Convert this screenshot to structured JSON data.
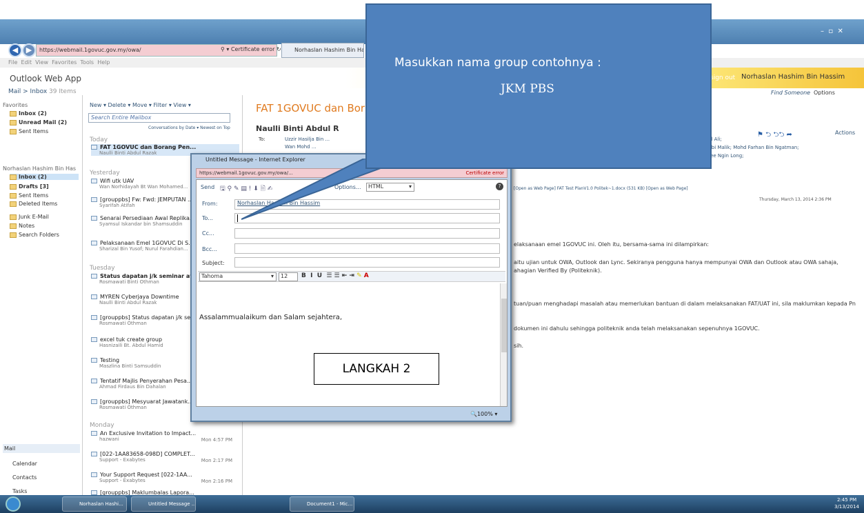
{
  "browser": {
    "url": "https://webmail.1govuc.gov.my/owa/",
    "cert": "Certificate error",
    "tab_title": "Norhaslan Hashim Bin Hass...",
    "menu": [
      "File",
      "Edit",
      "View",
      "Favorites",
      "Tools",
      "Help"
    ]
  },
  "owa": {
    "logo": "Outlook Web App",
    "signout": "sign out",
    "user": "Norhaslan Hashim Bin Hassim",
    "find": "Find Someone",
    "options": "Options",
    "breadcrumb": "Mail > Inbox",
    "count": "39 Items"
  },
  "nav": {
    "favorites": "Favorites",
    "inbox": "Inbox (2)",
    "unread": "Unread Mail (2)",
    "sent": "Sent Items",
    "account": "Norhaslan Hashim Bin Has",
    "inbox2": "Inbox (2)",
    "drafts": "Drafts [3]",
    "sent2": "Sent Items",
    "deleted": "Deleted Items",
    "junk": "Junk E-Mail",
    "notes": "Notes",
    "search": "Search Folders",
    "mail": "Mail",
    "calendar": "Calendar",
    "contacts": "Contacts",
    "tasks": "Tasks"
  },
  "list": {
    "toolbar": "New ▾  Delete ▾  Move ▾  Filter ▾  View ▾",
    "search": "Search Entire Mailbox",
    "sort": "Conversations by Date ▾  Newest on Top",
    "today": "Today",
    "yesterday": "Yesterday",
    "tuesday": "Tuesday",
    "monday": "Monday",
    "items": [
      {
        "s": "FAT 1GOVUC dan Borang Pen...",
        "f": "Naulli Binti Abdul Razak"
      },
      {
        "s": "Wifi utk UAV",
        "f": "Wan Norhidayah Bt Wan Mohamed..."
      },
      {
        "s": "[grouppbs] Fw: Fwd: JEMPUTAN ...",
        "f": "Syarifah Atifah"
      },
      {
        "s": "Senarai Persediaan Awal Replika...",
        "f": "Syamsul Iskandar bin Shamsuddin"
      },
      {
        "s": "Pelaksanaan Emel 1GOVUC Di S...",
        "f": "Sharizal Bin Yusof; Nurul Farahdian..."
      },
      {
        "s": "Status dapatan j/k seminar avi...",
        "f": "Rosmawati Binti Othman"
      },
      {
        "s": "MYREN Cyberjaya Downtime",
        "f": "Naulli Binti Abdul Razak"
      },
      {
        "s": "[grouppbs] Status dapatan j/k se...",
        "f": "Rosmawati Othman"
      },
      {
        "s": "excel tuk create group",
        "f": "Hasnizaili Bt. Abdul Hamid"
      },
      {
        "s": "Testing",
        "f": "Maszlina Binti Samsuddin"
      },
      {
        "s": "Tentatif Majlis Penyerahan Pesa...",
        "f": "Ahmad Firdaus Bin Dahalan"
      },
      {
        "s": "[grouppbs] Mesyuarat Jawatank...",
        "f": "Rosmawati Othman"
      },
      {
        "s": "An Exclusive Invitation to Impact...",
        "f": "hazwani",
        "t": "Mon 4:57 PM"
      },
      {
        "s": "[022-1AA83658-098D] COMPLET...",
        "f": "Support - Exabytes",
        "t": "Mon 2:17 PM"
      },
      {
        "s": "Your Support Request [022-1AA...",
        "f": "Support - Exabytes",
        "t": "Mon 2:16 PM"
      },
      {
        "s": "[grouppbs] Maklumbalas Lapora...",
        "f": ""
      }
    ]
  },
  "reading": {
    "subject": "FAT 1GOVUC dan Bor",
    "sender": "Naulli Binti Abdul R",
    "to_label": "To:",
    "to1": "Uzzir Hasilja Bin ...",
    "to2": "Wan Mohd ...",
    "cc1": "ul Ali;",
    "cc2": "Abi Malik; Mohd Farhan Bin Ngatman;",
    "cc3": "Tee Ngin Long;",
    "actions": "Actions",
    "attach": "[Open as Web Page]  FAT Test PlanV1.0 Politek~1.docx (531 KB) [Open as Web Page]",
    "date": "Thursday, March 13, 2014 2:36 PM",
    "b1": "elaksanaan emel 1GOVUC ini. Oleh itu, bersama-sama ini dilampirkan:",
    "b2": "aitu ujian untuk OWA, Outlook dan Lync. Sekiranya pengguna hanya mempunyai OWA dan Outlook atau OWA sahaja,",
    "b3": "ahagian Verified By (Politeknik).",
    "b4": "tuan/puan menghadapi masalah atau memerlukan bantuan di dalam melaksanakan FAT/UAT ini, sila maklumkan kepada Pn",
    "b5": "dokumen ini dahulu sehingga politeknik anda telah melaksanakan sepenuhnya 1GOVUC.",
    "b6": "sih."
  },
  "popup": {
    "title": "Untitled Message - Internet Explorer",
    "url": "https://webmail.1govuc.gov.my/owa/...",
    "cert": "Certificate error",
    "send": "Send",
    "options": "Options...",
    "format": "HTML",
    "from_label": "From:",
    "from": "Norhaslan Hashim Bin Hassim",
    "to_label": "To...",
    "cc_label": "Cc...",
    "bcc_label": "Bcc...",
    "subject_label": "Subject:",
    "font": "Tahoma",
    "size": "12",
    "body": "Assalammualaikum dan Salam sejahtera,",
    "zoom": "100%"
  },
  "callout": {
    "line1": "Masukkan nama group contohnya :",
    "line2": "JKM PBS"
  },
  "langkah": "LANGKAH 2",
  "taskbar": {
    "b1": "Norhaslan Hashi...",
    "b2": "Untitled Message ...",
    "b3": "Document1 - Mic...",
    "time": "2:45 PM",
    "date": "3/13/2014"
  }
}
